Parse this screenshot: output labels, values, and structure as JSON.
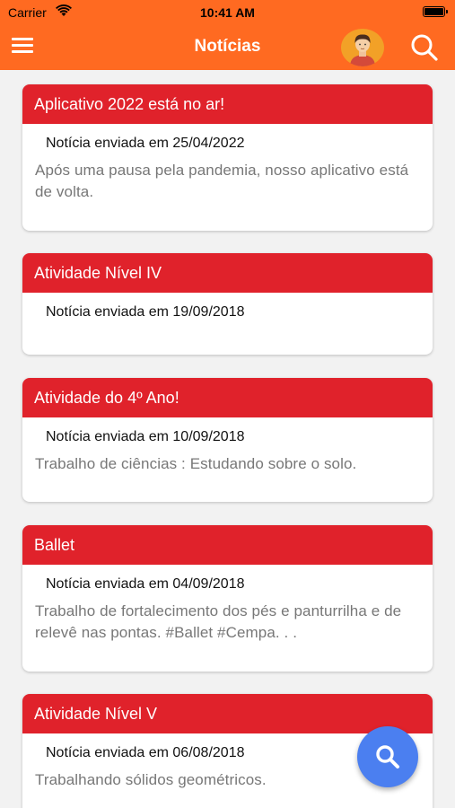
{
  "status_bar": {
    "carrier": "Carrier",
    "time": "10:41 AM"
  },
  "nav": {
    "title": "Notícias"
  },
  "news": [
    {
      "title": "Aplicativo 2022 está no ar!",
      "date": "Notícia enviada em 25/04/2022",
      "body": "Após uma pausa pela pandemia, nosso aplicativo está de volta."
    },
    {
      "title": "Atividade Nível IV",
      "date": "Notícia enviada em 19/09/2018",
      "body": ""
    },
    {
      "title": "Atividade do 4º Ano!",
      "date": "Notícia enviada em 10/09/2018",
      "body": "Trabalho de ciências : Estudando sobre o solo."
    },
    {
      "title": "Ballet",
      "date": "Notícia enviada em 04/09/2018",
      "body": "Trabalho de fortalecimento dos pés e panturrilha e de relevê nas pontas. #Ballet #Cempa. . ."
    },
    {
      "title": "Atividade Nível V",
      "date": "Notícia enviada em 06/08/2018",
      "body": "Trabalhando sólidos geométricos."
    }
  ],
  "colors": {
    "nav_bg": "#ff6a21",
    "card_header": "#e0222b",
    "fab": "#4b7ff0",
    "background": "#f2f2f2"
  },
  "icons": [
    "wifi-icon",
    "battery-icon",
    "menu-icon",
    "avatar-icon",
    "search-icon"
  ]
}
